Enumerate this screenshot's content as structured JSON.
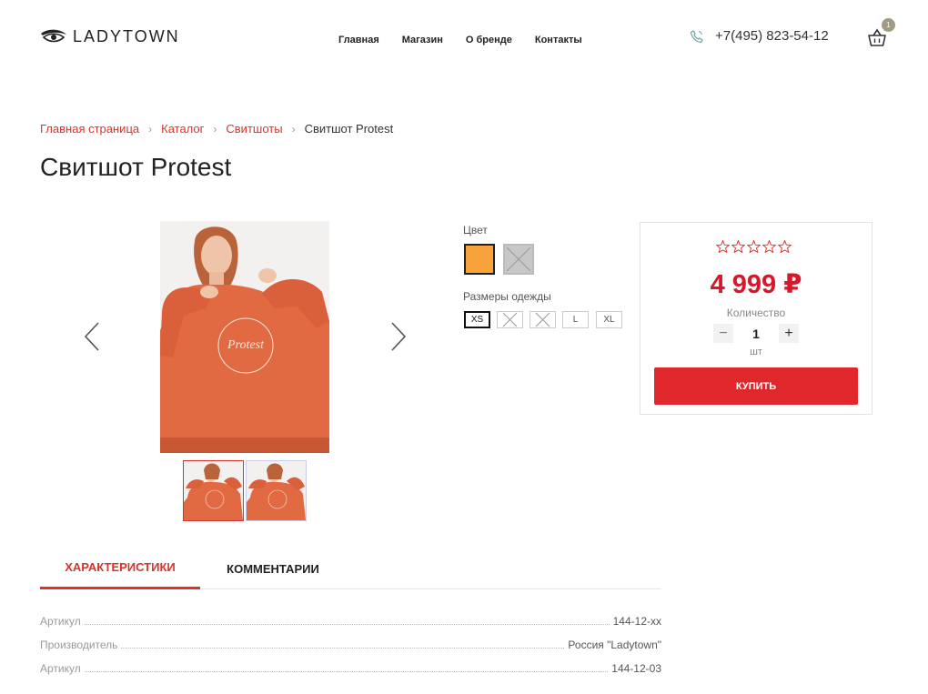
{
  "header": {
    "logo_text": "LADYTOWN",
    "nav": [
      "Главная",
      "Магазин",
      "О бренде",
      "Контакты"
    ],
    "phone": "+7(495) 823-54-12",
    "cart_count": "1"
  },
  "breadcrumb": {
    "items": [
      "Главная страница",
      "Каталог",
      "Свитшоты"
    ],
    "current": "Свитшот Protest"
  },
  "product": {
    "title": "Свитшот Protest",
    "color_label": "Цвет",
    "size_label": "Размеры одежды",
    "sizes": [
      "XS",
      "",
      "",
      "L",
      "XL"
    ],
    "price": "4 999 ₽",
    "qty_label": "Количество",
    "qty": "1",
    "qty_unit": "шт",
    "buy_label": "КУПИТЬ"
  },
  "tabs": [
    "ХАРАКТЕРИСТИКИ",
    "КОММЕНТАРИИ"
  ],
  "specs": [
    {
      "label": "Артикул",
      "value": "144-12-xx"
    },
    {
      "label": "Производитель",
      "value": "Россия \"Ladytown\""
    },
    {
      "label": "Артикул",
      "value": "144-12-03"
    }
  ],
  "colors": {
    "accent": "#d9342b",
    "price": "#d9172b",
    "swatch_orange": "#f7a23a"
  }
}
